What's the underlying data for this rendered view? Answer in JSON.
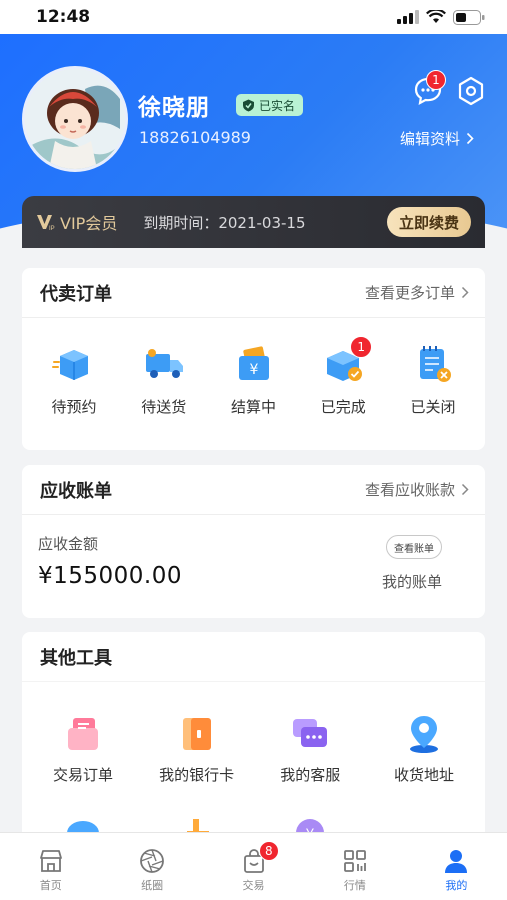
{
  "status_bar": {
    "time": "12:48"
  },
  "profile": {
    "name": "徐晓朋",
    "verified_label": "已实名",
    "phone": "18826104989",
    "edit_label": "编辑资料",
    "message_badge": "1"
  },
  "vip": {
    "label": "VIP会员",
    "expire_text": "到期时间：2021-03-15",
    "renew_label": "立即续费"
  },
  "orders": {
    "title": "代卖订单",
    "more_label": "查看更多订单",
    "items": [
      {
        "label": "待预约",
        "icon": "box-icon"
      },
      {
        "label": "待送货",
        "icon": "truck-icon"
      },
      {
        "label": "结算中",
        "icon": "wallet-yen-icon"
      },
      {
        "label": "已完成",
        "icon": "box-check-icon",
        "badge": "1"
      },
      {
        "label": "已关闭",
        "icon": "notepad-close-icon"
      }
    ]
  },
  "bills": {
    "title": "应收账单",
    "more_label": "查看应收账款",
    "amount_label": "应收金额",
    "amount": "¥155000.00",
    "view_bill_label": "查看账单",
    "my_bill_label": "我的账单"
  },
  "tools": {
    "title": "其他工具",
    "items": [
      {
        "label": "交易订单",
        "icon": "trade-order-icon"
      },
      {
        "label": "我的银行卡",
        "icon": "bank-card-icon"
      },
      {
        "label": "我的客服",
        "icon": "customer-service-icon"
      },
      {
        "label": "收货地址",
        "icon": "location-pin-icon"
      }
    ]
  },
  "tabbar": {
    "items": [
      {
        "label": "首页",
        "icon": "home-store-icon"
      },
      {
        "label": "纸圈",
        "icon": "aperture-icon"
      },
      {
        "label": "交易",
        "icon": "shopping-bag-icon",
        "badge": "8"
      },
      {
        "label": "行情",
        "icon": "grid-chart-icon"
      },
      {
        "label": "我的",
        "icon": "user-icon",
        "active": true
      }
    ]
  },
  "colors": {
    "primary": "#1c6ef5",
    "badge": "#f0262f",
    "vip_gold": "#e2c99b"
  }
}
